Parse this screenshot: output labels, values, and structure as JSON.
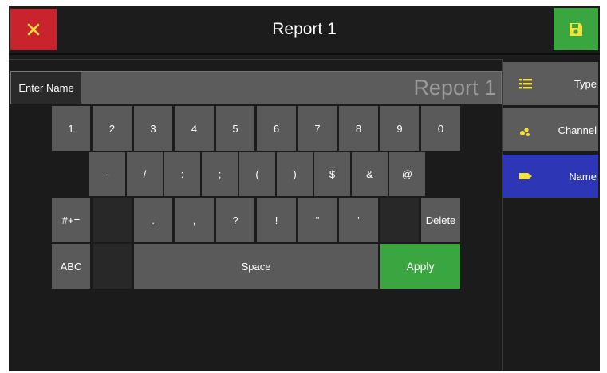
{
  "header": {
    "title": "Report 1",
    "close_icon": "close-icon",
    "save_icon": "save-icon"
  },
  "name_field": {
    "label": "Enter Name",
    "value": "Report 1"
  },
  "keyboard": {
    "row1": [
      "1",
      "2",
      "3",
      "4",
      "5",
      "6",
      "7",
      "8",
      "9",
      "0"
    ],
    "row2": [
      "-",
      "/",
      ":",
      ";",
      "(",
      ")",
      "$",
      "&",
      "@"
    ],
    "row3": [
      "#+=",
      "",
      ".",
      ",",
      "?",
      "!",
      "\"",
      "'",
      "",
      "Delete"
    ],
    "row4": [
      "ABC",
      "",
      "Space",
      "Apply"
    ]
  },
  "sidebar": {
    "tabs": [
      {
        "label": "Type",
        "icon": "list-icon"
      },
      {
        "label": "Channel",
        "icon": "channel-dots-icon"
      },
      {
        "label": "Name",
        "icon": "tag-icon",
        "active": true
      }
    ]
  },
  "colors": {
    "close": "#c9242d",
    "save": "#3aa640",
    "apply": "#3aa640",
    "active_tab": "#2d36b4",
    "icon_yellow": "#f2e23a"
  }
}
